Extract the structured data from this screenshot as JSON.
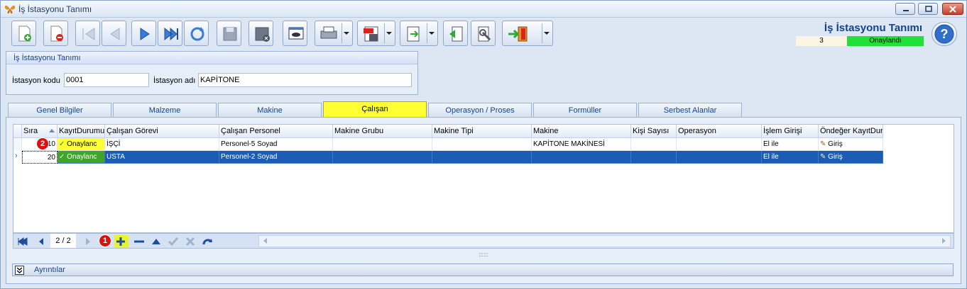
{
  "window": {
    "title": "İş İstasyonu Tanımı"
  },
  "header": {
    "title": "İş İstasyonu Tanımı",
    "record_number": "3",
    "status": "Onaylandı",
    "status_color": "#22e03a"
  },
  "toolbar": {
    "icons": [
      "new-document-icon",
      "delete-document-icon",
      "first-record-icon",
      "previous-record-icon",
      "next-record-icon",
      "last-record-icon",
      "refresh-icon",
      "save-icon",
      "save-close-icon",
      "preview-icon",
      "print-icon",
      "pdf-export-icon",
      "export-icon",
      "back-icon",
      "settings-icon",
      "exit-icon"
    ]
  },
  "groupbox": {
    "title": "İş İstasyonu Tanımı",
    "kod_label": "İstasyon kodu",
    "kod_value": "0001",
    "ad_label": "İstasyon adı",
    "ad_value": "KAPİTONE"
  },
  "tabs": [
    "Genel Bilgiler",
    "Malzeme",
    "Makine",
    "Çalışan",
    "Operasyon / Proses",
    "Formüller",
    "Serbest Alanlar"
  ],
  "active_tab": "Çalışan",
  "grid": {
    "columns": [
      "Sıra",
      "KayıtDurumu",
      "Çalışan Görevi",
      "Çalışan Personel",
      "Makine Grubu",
      "Makine Tipi",
      "Makine",
      "Kişi Sayısı",
      "Operasyon",
      "İşlem Girişi",
      "Öndeğer KayıtDur"
    ],
    "rows": [
      [
        "10",
        "Onaylanc",
        "İŞÇİ",
        "Personel-5 Soyad",
        "",
        "",
        "KAPİTONE MAKİNESİ",
        "",
        "",
        "El ile",
        "Giriş"
      ],
      [
        "20",
        "Onaylanc",
        "USTA",
        "Personel-2 Soyad",
        "",
        "",
        "",
        "",
        "",
        "El ile",
        "Giriş"
      ]
    ],
    "selected_row": 1
  },
  "navigator": {
    "page_info": "2 / 2"
  },
  "annotations": {
    "badge1": "1",
    "badge2": "2"
  },
  "details": {
    "label": "Ayrıntılar"
  }
}
